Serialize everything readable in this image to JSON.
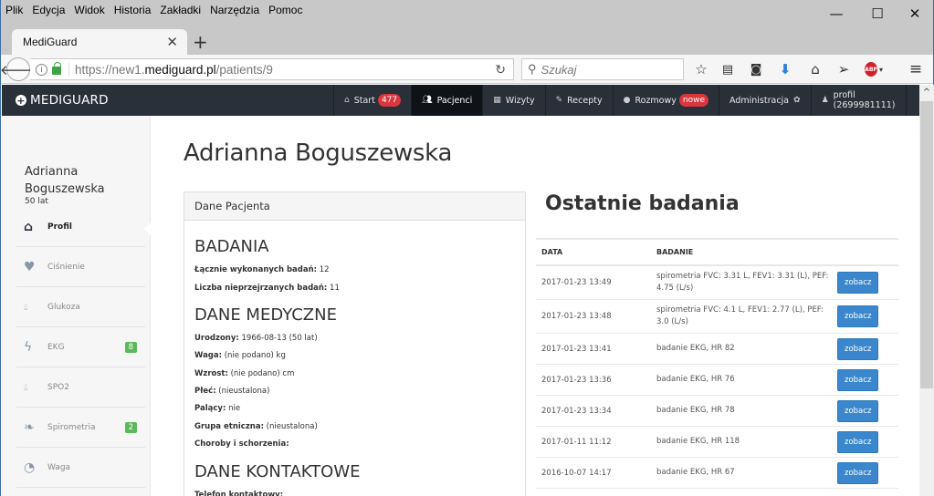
{
  "browser": {
    "menu": [
      "Plik",
      "Edycja",
      "Widok",
      "Historia",
      "Zakładki",
      "Narzędzia",
      "Pomoc"
    ],
    "tab_title": "MediGuard",
    "url_prefix": "https://new1.",
    "url_domain": "mediguard.pl",
    "url_path": "/patients/9",
    "search_placeholder": "Szukaj",
    "abp_label": "ABP"
  },
  "app": {
    "brand": "MEDIGUARD",
    "nav": [
      {
        "label": "Start",
        "icon": "home-icon",
        "badge": "477"
      },
      {
        "label": "Pacjenci",
        "icon": "users-icon",
        "active": true
      },
      {
        "label": "Wizyty",
        "icon": "calendar-icon"
      },
      {
        "label": "Recepty",
        "icon": "edit-icon"
      },
      {
        "label": "Rozmowy",
        "icon": "comments-icon",
        "badge": "nowe"
      },
      {
        "label": "Administracja",
        "icon": "gear-icon"
      },
      {
        "label": "profil (2699981111)",
        "icon": "user-icon"
      },
      {
        "label": "",
        "icon": "share-icon"
      }
    ]
  },
  "sidebar": {
    "patient_first": "Adrianna",
    "patient_last": "Boguszewska",
    "age": "50 lat",
    "items": [
      {
        "label": "Profil",
        "icon": "home-icon",
        "active": true
      },
      {
        "label": "Ciśnienie",
        "icon": "heart-icon"
      },
      {
        "label": "Glukoza",
        "icon": "drop-icon"
      },
      {
        "label": "EKG",
        "icon": "bolt-icon",
        "count": "8"
      },
      {
        "label": "SPO2",
        "icon": "drop-icon"
      },
      {
        "label": "Spirometria",
        "icon": "leaf-icon",
        "count": "2"
      },
      {
        "label": "Waga",
        "icon": "dashboard-icon"
      }
    ]
  },
  "main": {
    "title": "Adrianna Boguszewska",
    "panel_title": "Dane Pacjenta",
    "badania_heading": "BADANIA",
    "badania": [
      {
        "label": "Łącznie wykonanych badań:",
        "value": "12"
      },
      {
        "label": "Liczba nieprzejrzanych badań:",
        "value": "11"
      }
    ],
    "medyczne_heading": "DANE MEDYCZNE",
    "medyczne": [
      {
        "label": "Urodzony:",
        "value": "1966-08-13 (50 lat)"
      },
      {
        "label": "Waga:",
        "value": "(nie podano) kg"
      },
      {
        "label": "Wzrost:",
        "value": "(nie podano) cm"
      },
      {
        "label": "Płeć:",
        "value": "(nieustalona)"
      },
      {
        "label": "Palący:",
        "value": "nie"
      },
      {
        "label": "Grupa etniczna:",
        "value": "(nieustalona)"
      },
      {
        "label": "Choroby i schorzenia:",
        "value": ""
      }
    ],
    "kontaktowe_heading": "DANE KONTAKTOWE",
    "kontaktowe": [
      {
        "label": "Telefon kontaktowy:",
        "value": ""
      }
    ]
  },
  "recent": {
    "title": "Ostatnie badania",
    "col_date": "DATA",
    "col_exam": "BADANIE",
    "button_label": "zobacz",
    "rows": [
      {
        "date": "2017-01-23 13:49",
        "exam": "spirometria FVC: 3.31 L, FEV1: 3.31 (L), PEF: 4.75 (L/s)"
      },
      {
        "date": "2017-01-23 13:48",
        "exam": "spirometria FVC: 4.1 L, FEV1: 2.77 (L), PEF: 3.0 (L/s)"
      },
      {
        "date": "2017-01-23 13:41",
        "exam": "badanie EKG, HR 82"
      },
      {
        "date": "2017-01-23 13:36",
        "exam": "badanie EKG, HR 76"
      },
      {
        "date": "2017-01-23 13:34",
        "exam": "badanie EKG, HR 78"
      },
      {
        "date": "2017-01-11 11:12",
        "exam": "badanie EKG, HR 118"
      },
      {
        "date": "2016-10-07 14:17",
        "exam": "badanie EKG, HR 67"
      }
    ]
  }
}
